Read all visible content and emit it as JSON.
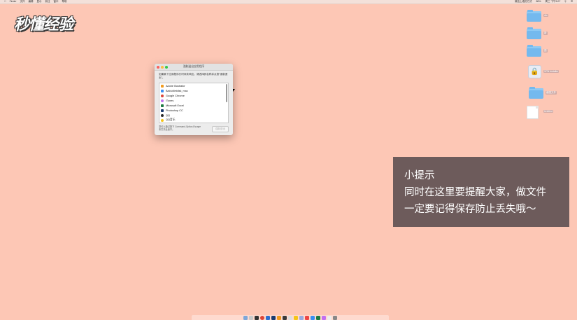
{
  "menubar": {
    "items": [
      "Finder",
      "文件",
      "编辑",
      "显示",
      "前往",
      "窗口",
      "帮助"
    ],
    "right_items": [
      "微信上墙的方式",
      "88%",
      "周三 下午5:07"
    ]
  },
  "logo": {
    "text": "秒懂经验"
  },
  "desktop": {
    "icons": [
      {
        "label": "dtc",
        "kind": "folder"
      },
      {
        "label": "新",
        "kind": "folder"
      },
      {
        "label": "图",
        "kind": "folder"
      },
      {
        "label": "VPN Installer",
        "kind": "vpn"
      },
      {
        "label": "截图文件",
        "kind": "folder"
      },
      {
        "label": "Untitled",
        "kind": "document"
      }
    ]
  },
  "dialog": {
    "title": "强制退出应用程序",
    "description": "如果某个应用程序长时间未响应，请选择其名称并点按\"强制退出\"。",
    "apps": [
      {
        "name": "Adobe Illustrator",
        "color": "#f29b1d"
      },
      {
        "name": "BaiduNetdisk_mac",
        "color": "#3a8ef2"
      },
      {
        "name": "Google Chrome",
        "color": "#db4437"
      },
      {
        "name": "iTunes",
        "color": "#c46ef0"
      },
      {
        "name": "Microsoft Excel",
        "color": "#1f7a44"
      },
      {
        "name": "Photoshop CC",
        "color": "#1b3b6f"
      },
      {
        "name": "QQ",
        "color": "#2a2a2a"
      },
      {
        "name": "QQ音乐",
        "color": "#f5c518"
      }
    ],
    "footer_text": "您可以通过按下 Command-Option-Escape 来打开此窗口。",
    "force_quit_label": "强制退出"
  },
  "tip": {
    "title": "小提示",
    "line1": "同时在这里要提醒大家，做文件",
    "line2": "一定要记得保存防止丢失哦～"
  },
  "colors": {
    "desktop_bg": "#fdc7b5",
    "tip_bg": "#6d5b5b",
    "folder": "#74b9ee"
  }
}
